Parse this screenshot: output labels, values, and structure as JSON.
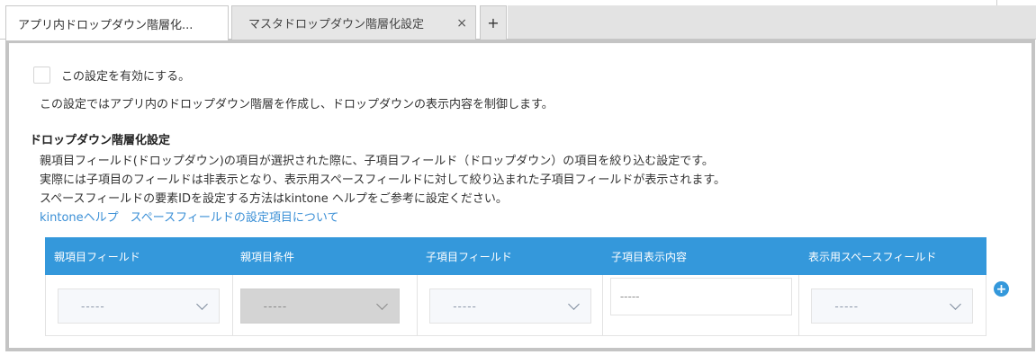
{
  "tabs": [
    {
      "label": "アプリ内ドロップダウン階層化..."
    },
    {
      "label": "マスタドロップダウン階層化設定",
      "close": "×"
    },
    {
      "label": "+"
    }
  ],
  "settings": {
    "enable_label": "この設定を有効にする。",
    "description": "この設定ではアプリ内のドロップダウン階層を作成し、ドロップダウンの表示内容を制御します。",
    "section_title": "ドロップダウン階層化設定",
    "explain_lines": [
      "親項目フィールド(ドロップダウン)の項目が選択された際に、子項目フィールド（ドロップダウン）の項目を絞り込む設定です。",
      "実際には子項目のフィールドは非表示となり、表示用スペースフィールドに対して絞り込まれた子項目フィールドが表示されます。",
      "スペースフィールドの要素IDを設定する方法はkintone ヘルプをご参考に設定ください。"
    ],
    "help_link": "kintoneヘルプ　スペースフィールドの設定項目について"
  },
  "table": {
    "headers": [
      "親項目フィールド",
      "親項目条件",
      "子項目フィールド",
      "子項目表示内容",
      "表示用スペースフィールド"
    ],
    "row": {
      "parent_field": "-----",
      "parent_condition": "-----",
      "child_field": "-----",
      "child_display": "-----",
      "space_field": "-----"
    },
    "add_symbol": "+"
  },
  "colors": {
    "accent": "#3498db",
    "link": "#3a8fd6",
    "panel_border": "#c4c4c4"
  }
}
